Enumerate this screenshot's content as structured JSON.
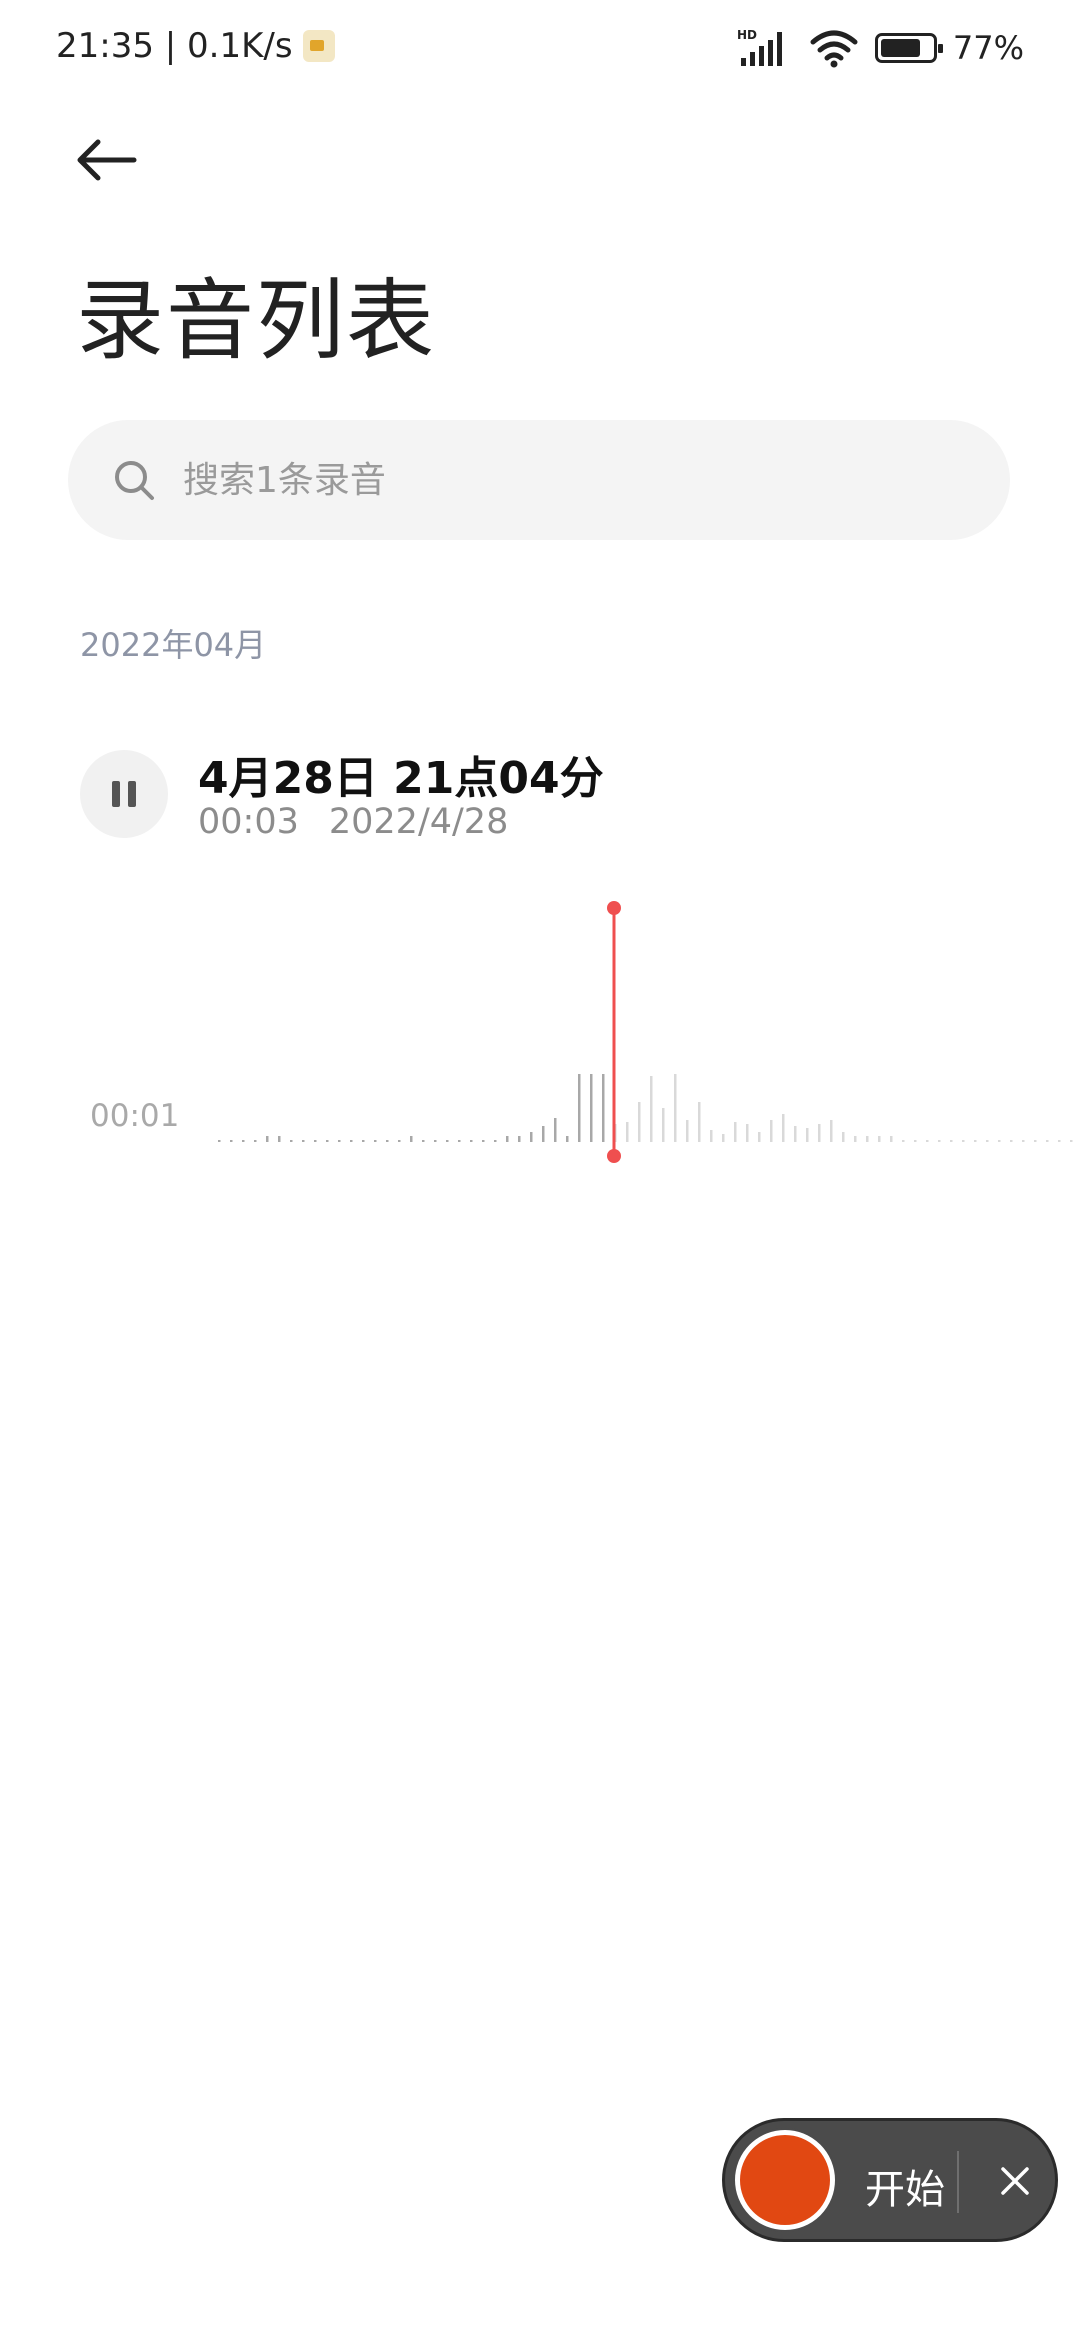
{
  "status_bar": {
    "time_speed": "21:35 | 0.1K/s",
    "network_badge": "HD",
    "battery_percent": "77%",
    "battery_level": 0.77,
    "icons": [
      "video-camera-icon",
      "signal-icon",
      "wifi-icon",
      "battery-icon"
    ]
  },
  "header": {
    "back_icon": "arrow-left-icon",
    "title": "录音列表"
  },
  "search": {
    "placeholder": "搜索1条录音",
    "value": ""
  },
  "list": {
    "section_header": "2022年04月",
    "items": [
      {
        "title": "4月28日 21点04分",
        "duration": "00:03",
        "date": "2022/4/28",
        "state_icon": "pause-icon"
      }
    ]
  },
  "waveform": {
    "current_time": "00:01",
    "playhead_color": "#ef4f4f",
    "bar_color_played": "#a8a8a8",
    "bar_color_unplayed": "#d9d9d9"
  },
  "recorder": {
    "start_label": "开始",
    "record_color": "#e14812",
    "close_icon": "close-icon"
  }
}
